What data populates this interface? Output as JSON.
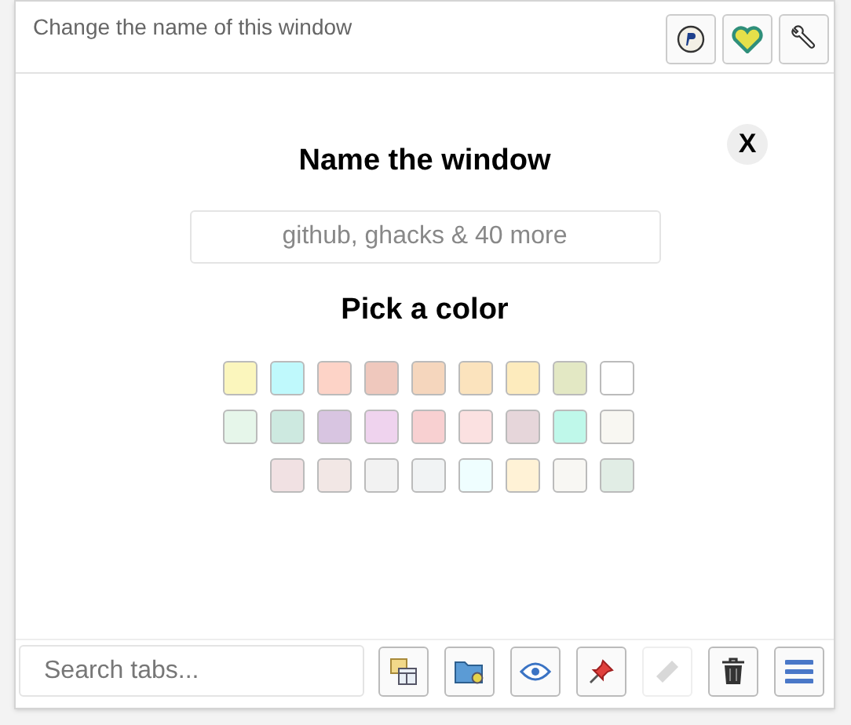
{
  "header": {
    "title": "Change the name of this window"
  },
  "header_buttons": [
    {
      "kind": "coin"
    },
    {
      "kind": "heart"
    },
    {
      "kind": "wrench"
    }
  ],
  "dialog": {
    "heading": "Name the window",
    "close": "X",
    "name_field": {
      "placeholder": "github, ghacks & 40 more"
    },
    "color_heading": "Pick a color"
  },
  "color_rows": [
    {
      "swatches": [
        {
          "color": "#fbf6bd"
        },
        {
          "color": "#bff9fc"
        },
        {
          "color": "#fdd3c7"
        },
        {
          "color": "#efc8bd"
        },
        {
          "color": "#f5d6bd"
        },
        {
          "color": "#fbe3bd"
        },
        {
          "color": "#fdebbd"
        },
        {
          "color": "#e3e8c4"
        },
        {
          "color": "#ffffff"
        }
      ]
    },
    {
      "swatches": [
        {
          "color": "#e6f6ea"
        },
        {
          "color": "#cde9e0"
        },
        {
          "color": "#d8c5e1"
        },
        {
          "color": "#efd3ee"
        },
        {
          "color": "#f8d0d1"
        },
        {
          "color": "#fbe1e1"
        },
        {
          "color": "#e6d6da"
        },
        {
          "color": "#bff8ea"
        },
        {
          "color": "#f8f7f2"
        }
      ]
    },
    {
      "swatches": [
        {
          "color": "#f1e1e3"
        },
        {
          "color": "#f2e7e5"
        },
        {
          "color": "#f2f2f2"
        },
        {
          "color": "#f1f3f4"
        },
        {
          "color": "#effeff"
        },
        {
          "color": "#fff2d6"
        },
        {
          "color": "#f8f7f3"
        },
        {
          "color": "#e1ede5"
        }
      ]
    }
  ],
  "bottom": {
    "search": {
      "placeholder": "Search tabs..."
    },
    "buttons": [
      {
        "kind": "windows",
        "disabled": false
      },
      {
        "kind": "folder",
        "disabled": false
      },
      {
        "kind": "eye",
        "disabled": false
      },
      {
        "kind": "pin",
        "disabled": false
      },
      {
        "kind": "tag",
        "disabled": true
      },
      {
        "kind": "trash",
        "disabled": false
      },
      {
        "kind": "menu",
        "disabled": false
      }
    ]
  }
}
